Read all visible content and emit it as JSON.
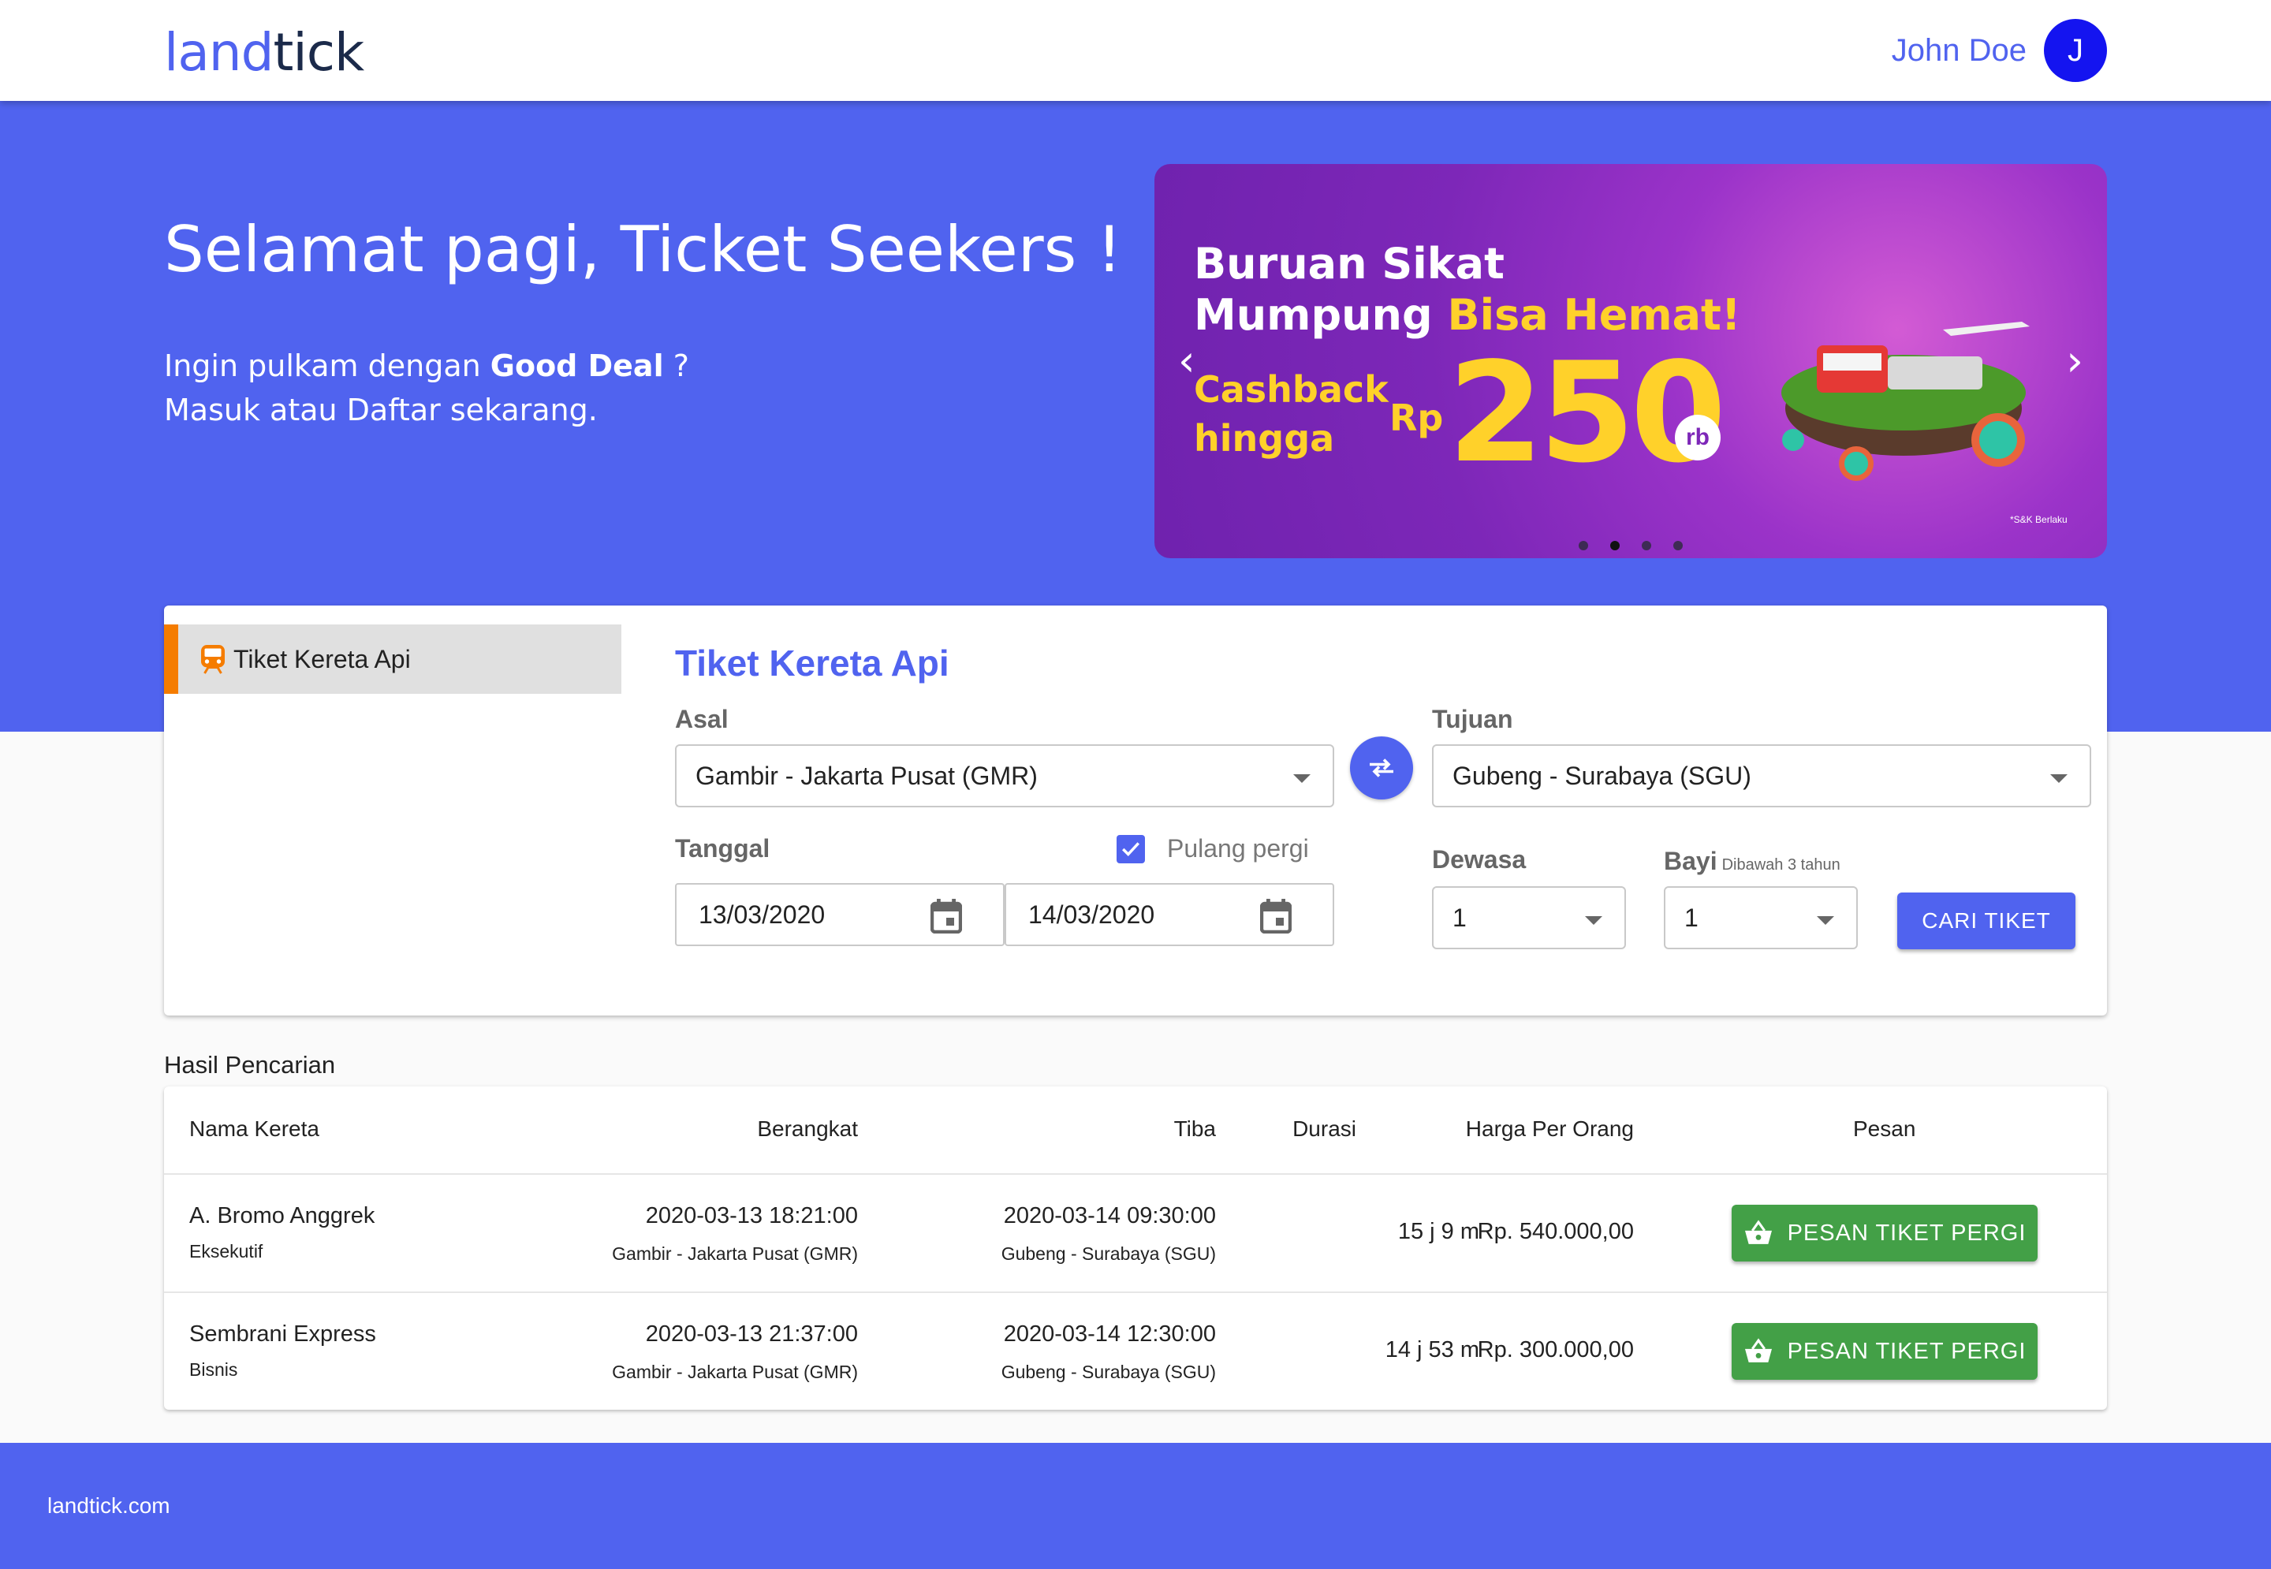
{
  "header": {
    "logo_part1": "land",
    "logo_part2": "tick",
    "user_name": "John Doe",
    "avatar_initial": "J"
  },
  "hero": {
    "greeting": "Selamat pagi, Ticket Seekers !",
    "sub_prefix": "Ingin pulkam dengan ",
    "sub_bold": "Good Deal",
    "sub_suffix": " ?",
    "sub_line2": "Masuk atau Daftar sekarang."
  },
  "banner": {
    "line1": "Buruan Sikat",
    "line2_white": "Mumpung ",
    "line2_yellow": "Bisa Hemat!",
    "cashback": "Cashback",
    "hingga": "hingga",
    "rp": "Rp",
    "amount": "250",
    "unit": "rb",
    "terms": "*S&K Berlaku",
    "prev_arrow": "‹",
    "next_arrow": "›",
    "slide_count": 4,
    "active_slide": 2
  },
  "search": {
    "side_tab_label": "Tiket Kereta Api",
    "side_tab_icon": "train-icon",
    "title": "Tiket Kereta Api",
    "asal_label": "Asal",
    "asal_value": "Gambir - Jakarta Pusat (GMR)",
    "tujuan_label": "Tujuan",
    "tujuan_value": "Gubeng - Surabaya (SGU)",
    "tanggal_label": "Tanggal",
    "pulang_pergi_label": "Pulang pergi",
    "pulang_pergi_checked": true,
    "date_depart": "13/03/2020",
    "date_return": "14/03/2020",
    "dewasa_label": "Dewasa",
    "dewasa_value": "1",
    "bayi_label": "Bayi",
    "bayi_note": "Dibawah 3 tahun",
    "bayi_value": "1",
    "search_button": "CARI TIKET",
    "accent_color": "#5063ef",
    "tab_accent_color": "#f57c00"
  },
  "results": {
    "title": "Hasil Pencarian",
    "headers": {
      "name": "Nama Kereta",
      "depart": "Berangkat",
      "arrive": "Tiba",
      "duration": "Durasi",
      "price": "Harga Per Orang",
      "order": "Pesan"
    },
    "rows": [
      {
        "name": "A. Bromo Anggrek",
        "class": "Eksekutif",
        "depart_time": "2020-03-13 18:21:00",
        "depart_station": "Gambir - Jakarta Pusat (GMR)",
        "arrive_time": "2020-03-14 09:30:00",
        "arrive_station": "Gubeng - Surabaya (SGU)",
        "duration": "15 j 9 m",
        "price": "Rp. 540.000,00",
        "button": "PESAN TIKET PERGI"
      },
      {
        "name": "Sembrani Express",
        "class": "Bisnis",
        "depart_time": "2020-03-13 21:37:00",
        "depart_station": "Gambir - Jakarta Pusat (GMR)",
        "arrive_time": "2020-03-14 12:30:00",
        "arrive_station": "Gubeng - Surabaya (SGU)",
        "duration": "14 j 53 m",
        "price": "Rp. 300.000,00",
        "button": "PESAN TIKET PERGI"
      }
    ],
    "button_color": "#43a047"
  },
  "footer": {
    "text": "landtick.com"
  }
}
